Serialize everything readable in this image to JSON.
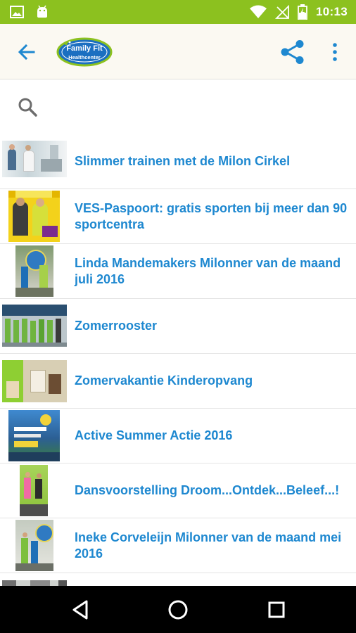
{
  "status_bar": {
    "time": "10:13",
    "left_icons": [
      "image-icon",
      "android-icon"
    ],
    "right_icons": [
      "wifi-icon",
      "no-signal-icon",
      "battery-charging-icon"
    ],
    "background": "#8cc11f"
  },
  "app_bar": {
    "logo_text_top": "Family Fit",
    "logo_text_bottom": "Healthcenter",
    "accent": "#1e88d0",
    "background": "#fbf9f2"
  },
  "search": {
    "placeholder": "",
    "value": ""
  },
  "news": [
    {
      "title": "Slimmer trainen met de Milon Cirkel"
    },
    {
      "title": "VES-Paspoort: gratis sporten bij meer dan 90 sportcentra"
    },
    {
      "title": "Linda Mandemakers Milonner van de maand juli 2016"
    },
    {
      "title": "Zomerrooster"
    },
    {
      "title": "Zomervakantie Kinderopvang"
    },
    {
      "title": "Active Summer Actie 2016"
    },
    {
      "title": "Dansvoorstelling Droom...Ontdek...Beleef...!"
    },
    {
      "title": "Ineke Corveleijn Milonner van de maand mei 2016"
    },
    {
      "title": ""
    }
  ]
}
